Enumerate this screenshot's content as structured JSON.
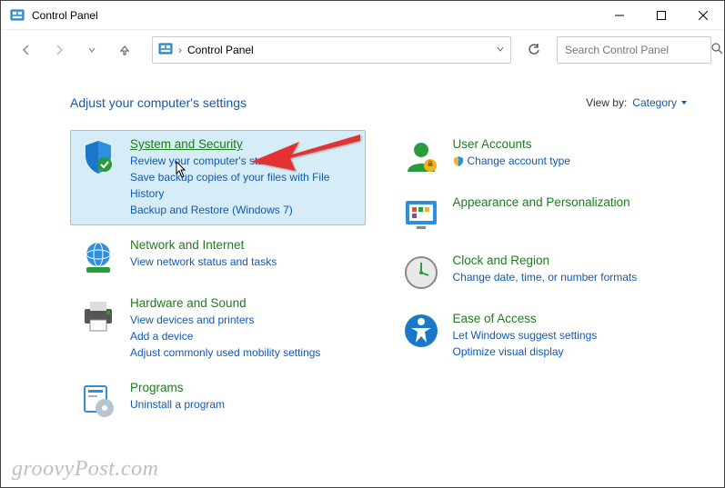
{
  "titlebar": {
    "title": "Control Panel"
  },
  "address": {
    "breadcrumb": "Control Panel",
    "chevron": "›"
  },
  "search": {
    "placeholder": "Search Control Panel"
  },
  "heading": "Adjust your computer's settings",
  "viewby": {
    "label": "View by:",
    "value": "Category"
  },
  "categories": {
    "system_security": {
      "title": "System and Security",
      "links": [
        "Review your computer's status",
        "Save backup copies of your files with File History",
        "Backup and Restore (Windows 7)"
      ]
    },
    "network": {
      "title": "Network and Internet",
      "links": [
        "View network status and tasks"
      ]
    },
    "hardware": {
      "title": "Hardware and Sound",
      "links": [
        "View devices and printers",
        "Add a device",
        "Adjust commonly used mobility settings"
      ]
    },
    "programs": {
      "title": "Programs",
      "links": [
        "Uninstall a program"
      ]
    },
    "user_accounts": {
      "title": "User Accounts",
      "links": [
        "Change account type"
      ]
    },
    "appearance": {
      "title": "Appearance and Personalization",
      "links": []
    },
    "clock": {
      "title": "Clock and Region",
      "links": [
        "Change date, time, or number formats"
      ]
    },
    "ease": {
      "title": "Ease of Access",
      "links": [
        "Let Windows suggest settings",
        "Optimize visual display"
      ]
    }
  },
  "watermark": "groovyPost.com"
}
